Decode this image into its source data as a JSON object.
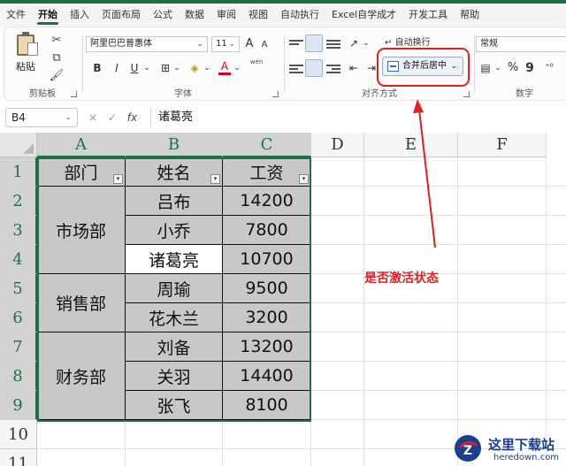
{
  "menu": {
    "tabs": [
      "文件",
      "开始",
      "插入",
      "页面布局",
      "公式",
      "数据",
      "审阅",
      "视图",
      "自动执行",
      "Excel自学成才",
      "开发工具",
      "帮助"
    ],
    "active_index": 1
  },
  "ribbon": {
    "clipboard": {
      "paste_label": "粘贴",
      "group_label": "剪贴板"
    },
    "font": {
      "font_name": "阿里巴巴普惠体",
      "font_size": "11",
      "grow_label": "A",
      "shrink_label": "A",
      "bold": "B",
      "italic": "I",
      "underline": "U",
      "font_color_letter": "A",
      "wen_label": "wén",
      "group_label": "字体"
    },
    "alignment": {
      "wrap_label": "自动换行",
      "merge_label": "合并后居中",
      "group_label": "对齐方式"
    },
    "number": {
      "format": "常规",
      "percent": "%",
      "comma": "9",
      "group_label": "数字"
    }
  },
  "formula_bar": {
    "name_box": "B4",
    "cancel": "×",
    "confirm": "✓",
    "fx": "fx",
    "content": "诸葛亮"
  },
  "grid": {
    "columns": [
      "A",
      "B",
      "C",
      "D",
      "E",
      "F"
    ],
    "rows": [
      "1",
      "2",
      "3",
      "4",
      "5",
      "6",
      "7",
      "8",
      "9",
      "10",
      "11"
    ],
    "header": [
      "部门",
      "姓名",
      "工资"
    ],
    "departments": [
      {
        "name": "市场部",
        "rows": 3
      },
      {
        "name": "销售部",
        "rows": 2
      },
      {
        "name": "财务部",
        "rows": 3
      }
    ],
    "records": [
      {
        "name": "吕布",
        "salary": "14200"
      },
      {
        "name": "小乔",
        "salary": "7800"
      },
      {
        "name": "诸葛亮",
        "salary": "10700"
      },
      {
        "name": "周瑜",
        "salary": "9500"
      },
      {
        "name": "花木兰",
        "salary": "3200"
      },
      {
        "name": "刘备",
        "salary": "13200"
      },
      {
        "name": "关羽",
        "salary": "14400"
      },
      {
        "name": "张飞",
        "salary": "8100"
      }
    ],
    "active_cell": "B4",
    "filter_glyph": "▾"
  },
  "annotation": {
    "text": "是否激活状态",
    "color": "#e02020"
  },
  "watermark": {
    "title": "这里下载站",
    "url": "heredown.com"
  },
  "colors": {
    "accent": "#1e7145",
    "annotation": "#e02020",
    "selected_cells": "#c8c8c8"
  }
}
